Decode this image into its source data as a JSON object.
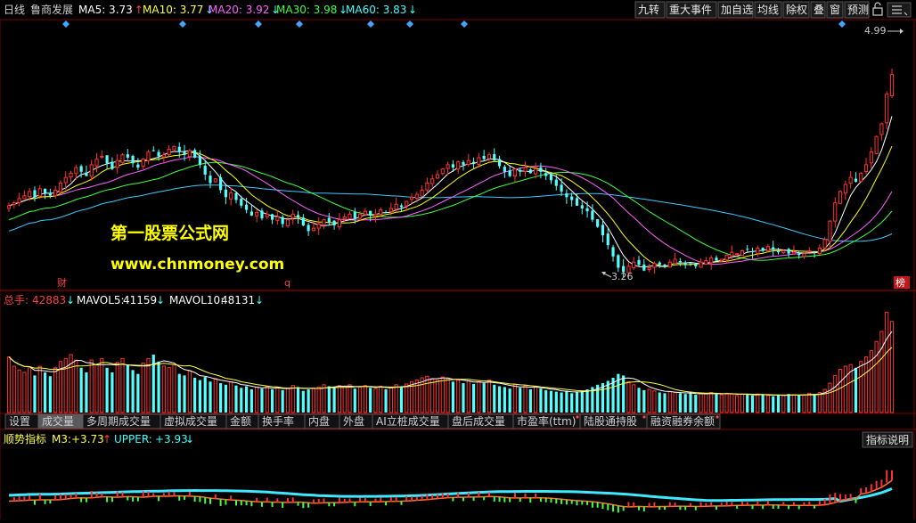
{
  "header": {
    "period": "日线",
    "stock_name": "鲁商发展",
    "ma": [
      {
        "label": "MA5:",
        "value": "3.73",
        "arrow": "↑",
        "color": "#ffffff",
        "arrow_color": "#ff4040"
      },
      {
        "label": "MA10:",
        "value": "3.77",
        "arrow": "↓",
        "color": "#ffff40",
        "arrow_color": "#40ffff"
      },
      {
        "label": "MA20:",
        "value": "3.92",
        "arrow": "↓",
        "color": "#ff60ff",
        "arrow_color": "#40ffff"
      },
      {
        "label": "MA30:",
        "value": "3.98",
        "arrow": "↓",
        "color": "#40ff40",
        "arrow_color": "#40ffff"
      },
      {
        "label": "MA60:",
        "value": "3.83",
        "arrow": "↓",
        "color": "#40ffff",
        "arrow_color": "#40ffff"
      }
    ],
    "buttons": [
      "九转",
      "重大事件",
      "加自选",
      "均线",
      "除权",
      "叠",
      "窗",
      "预测"
    ],
    "lock_icon": "lock-icon",
    "menu_icon": "menu-icon"
  },
  "price_chart": {
    "high_marker": "4.99",
    "low_marker": "3.26",
    "badges": {
      "cai": "财",
      "q": "q",
      "bang": "榜"
    },
    "watermark_line1": "第一股票公式网",
    "watermark_line2": "www.chnmoney.com"
  },
  "volume_chart": {
    "label": "总手:",
    "value": "42883",
    "value_arrow": "↓",
    "mavol5_label": "MAVOL5:",
    "mavol5_value": "41159",
    "mavol5_arrow": "↓",
    "mavol10_label": "MAVOL10:",
    "mavol10_value": "48131",
    "mavol10_arrow": "↓"
  },
  "tabs": [
    {
      "label": "设置",
      "active": false,
      "dot": false
    },
    {
      "label": "成交量",
      "active": true,
      "dot": false
    },
    {
      "label": "多周期成交量",
      "active": false,
      "dot": false
    },
    {
      "label": "虚拟成交量",
      "active": false,
      "dot": false
    },
    {
      "label": "金额",
      "active": false,
      "dot": false
    },
    {
      "label": "换手率",
      "active": false,
      "dot": false
    },
    {
      "label": "内盘",
      "active": false,
      "dot": false
    },
    {
      "label": "外盘",
      "active": false,
      "dot": false
    },
    {
      "label": "AI立桩成交量",
      "active": false,
      "dot": false
    },
    {
      "label": "盘后成交量",
      "active": false,
      "dot": false
    },
    {
      "label": "市盈率(ttm)",
      "active": false,
      "dot": true
    },
    {
      "label": "陆股通持股",
      "active": false,
      "dot": true
    },
    {
      "label": "融资融券余额",
      "active": false,
      "dot": true
    }
  ],
  "indicator": {
    "name": "顺势指标",
    "m3_label": "M3:",
    "m3_value": "+3.73",
    "m3_arrow": "↑",
    "upper_label": "UPPER:",
    "upper_value": "+3.93",
    "upper_arrow": "↓",
    "help_button": "指标说明"
  },
  "colors": {
    "up": "#ff3232",
    "down": "#54ffff",
    "ma5": "#ffffff",
    "ma10": "#ffff00",
    "ma20": "#ff60ff",
    "ma30": "#40ff40",
    "ma60": "#40c8ff",
    "upper_line": "#40e8ff",
    "m3_line": "#ff7030"
  },
  "chart_data": {
    "type": "candlestick",
    "price_range": [
      3.26,
      4.99
    ],
    "candles_close": [
      3.76,
      3.78,
      3.81,
      3.83,
      3.86,
      3.82,
      3.88,
      3.85,
      3.83,
      3.87,
      3.92,
      3.96,
      3.99,
      4.03,
      4.0,
      3.97,
      4.05,
      4.09,
      4.11,
      4.06,
      4.02,
      4.08,
      4.12,
      4.1,
      4.06,
      4.03,
      4.09,
      4.14,
      4.15,
      4.11,
      4.12,
      4.16,
      4.18,
      4.14,
      4.12,
      4.15,
      4.1,
      4.05,
      3.98,
      3.92,
      3.95,
      3.87,
      3.82,
      3.85,
      3.8,
      3.76,
      3.73,
      3.69,
      3.71,
      3.67,
      3.7,
      3.66,
      3.68,
      3.63,
      3.66,
      3.7,
      3.68,
      3.62,
      3.58,
      3.6,
      3.63,
      3.66,
      3.64,
      3.62,
      3.66,
      3.68,
      3.7,
      3.67,
      3.7,
      3.72,
      3.69,
      3.7,
      3.73,
      3.71,
      3.74,
      3.77,
      3.75,
      3.79,
      3.82,
      3.84,
      3.87,
      3.92,
      3.95,
      3.98,
      4.02,
      4.05,
      4.03,
      4.07,
      4.05,
      4.08,
      4.06,
      4.1,
      4.09,
      4.12,
      4.08,
      4.04,
      4.0,
      3.97,
      4.02,
      4.0,
      4.03,
      3.99,
      4.02,
      4.0,
      3.97,
      3.94,
      3.9,
      3.86,
      3.82,
      3.8,
      3.76,
      3.74,
      3.72,
      3.66,
      3.61,
      3.55,
      3.48,
      3.4,
      3.32,
      3.29,
      3.33,
      3.36,
      3.34,
      3.3,
      3.32,
      3.35,
      3.34,
      3.33,
      3.36,
      3.38,
      3.36,
      3.34,
      3.35,
      3.33,
      3.36,
      3.37,
      3.39,
      3.37,
      3.38,
      3.41,
      3.43,
      3.42,
      3.44,
      3.45,
      3.43,
      3.46,
      3.44,
      3.47,
      3.45,
      3.43,
      3.44,
      3.42,
      3.43,
      3.41,
      3.42,
      3.44,
      3.43,
      3.46,
      3.52,
      3.65,
      3.78,
      3.86,
      3.91,
      3.96,
      3.93,
      3.99,
      4.05,
      4.14,
      4.25,
      4.34,
      4.55,
      4.69
    ],
    "volume": [
      72000,
      60000,
      55000,
      52000,
      58000,
      48000,
      60000,
      52000,
      47000,
      58000,
      66000,
      70000,
      75000,
      68000,
      58000,
      52000,
      68000,
      62000,
      70000,
      58000,
      52000,
      65000,
      70000,
      62000,
      55000,
      50000,
      64000,
      70000,
      75000,
      66000,
      60000,
      58000,
      62000,
      50000,
      48000,
      54000,
      45000,
      42000,
      46000,
      40000,
      44000,
      38000,
      36000,
      40000,
      35000,
      32000,
      34000,
      30000,
      33000,
      31000,
      34000,
      30000,
      32000,
      29000,
      31000,
      35000,
      33000,
      28000,
      30000,
      31000,
      33000,
      36000,
      34000,
      32000,
      35000,
      34000,
      36000,
      31000,
      33000,
      35000,
      32000,
      31000,
      34000,
      30000,
      33000,
      36000,
      34000,
      37000,
      40000,
      42000,
      45000,
      47000,
      44000,
      42000,
      46000,
      44000,
      40000,
      42000,
      38000,
      41000,
      37000,
      40000,
      38000,
      42000,
      36000,
      34000,
      33000,
      31000,
      36000,
      32000,
      35000,
      30000,
      33000,
      31000,
      29000,
      28000,
      27000,
      26000,
      28000,
      25000,
      27000,
      28000,
      30000,
      33000,
      36000,
      38000,
      41000,
      45000,
      50000,
      48000,
      40000,
      36000,
      32000,
      29000,
      30000,
      28000,
      26000,
      25000,
      27000,
      26000,
      25000,
      24000,
      25000,
      23000,
      25000,
      24000,
      26000,
      24000,
      23000,
      25000,
      24000,
      22000,
      24000,
      23000,
      22000,
      24000,
      23000,
      22000,
      21000,
      23000,
      22000,
      24000,
      23000,
      22000,
      23000,
      25000,
      24000,
      26000,
      30000,
      38000,
      48000,
      56000,
      60000,
      62000,
      58000,
      66000,
      72000,
      80000,
      92000,
      105000,
      130000,
      118000
    ]
  }
}
